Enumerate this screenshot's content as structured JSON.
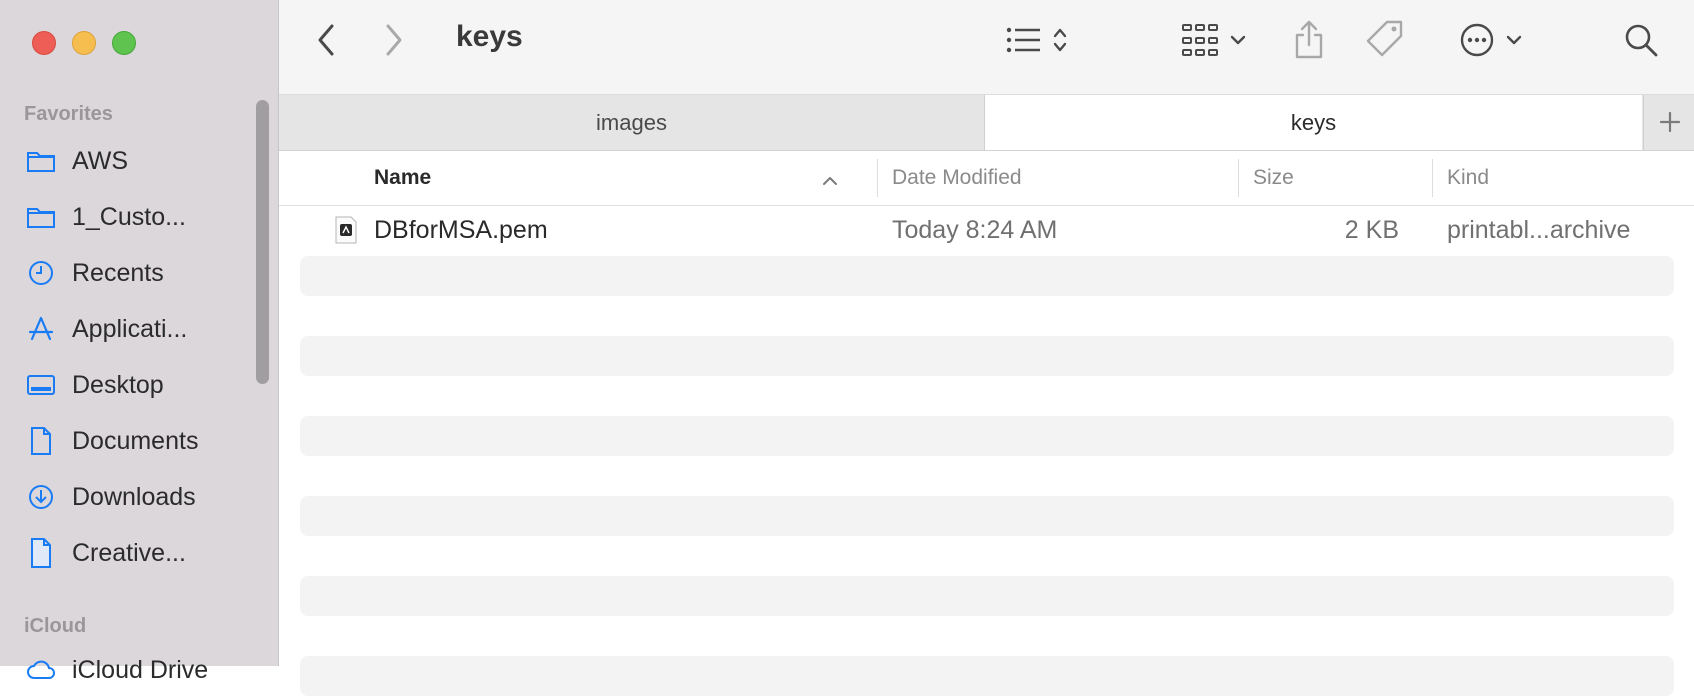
{
  "window": {
    "title": "keys"
  },
  "sidebar": {
    "favorites_label": "Favorites",
    "items": [
      {
        "label": "AWS",
        "icon": "folder-icon"
      },
      {
        "label": "1_Custo...",
        "icon": "folder-icon"
      },
      {
        "label": "Recents",
        "icon": "clock-icon"
      },
      {
        "label": "Applicati...",
        "icon": "applications-icon"
      },
      {
        "label": "Desktop",
        "icon": "desktop-icon"
      },
      {
        "label": "Documents",
        "icon": "document-icon"
      },
      {
        "label": "Downloads",
        "icon": "download-icon"
      },
      {
        "label": "Creative...",
        "icon": "file-icon"
      }
    ],
    "icloud_label": "iCloud",
    "icloud_items": [
      {
        "label": "iCloud Drive",
        "icon": "cloud-icon"
      }
    ]
  },
  "tabs": [
    {
      "label": "images",
      "active": false
    },
    {
      "label": "keys",
      "active": true
    }
  ],
  "columns": {
    "name": "Name",
    "date": "Date Modified",
    "size": "Size",
    "kind": "Kind"
  },
  "files": [
    {
      "name": "DBforMSA.pem",
      "date": "Today 8:24 AM",
      "size": "2 KB",
      "kind": "printabl...archive",
      "icon": "certificate-file-icon"
    }
  ],
  "colors": {
    "accent": "#1a7cf5",
    "sidebar_bg": "#dbd7db",
    "close": "#ee5e56",
    "minimize": "#f6be4f",
    "maximize": "#5ec44f"
  }
}
